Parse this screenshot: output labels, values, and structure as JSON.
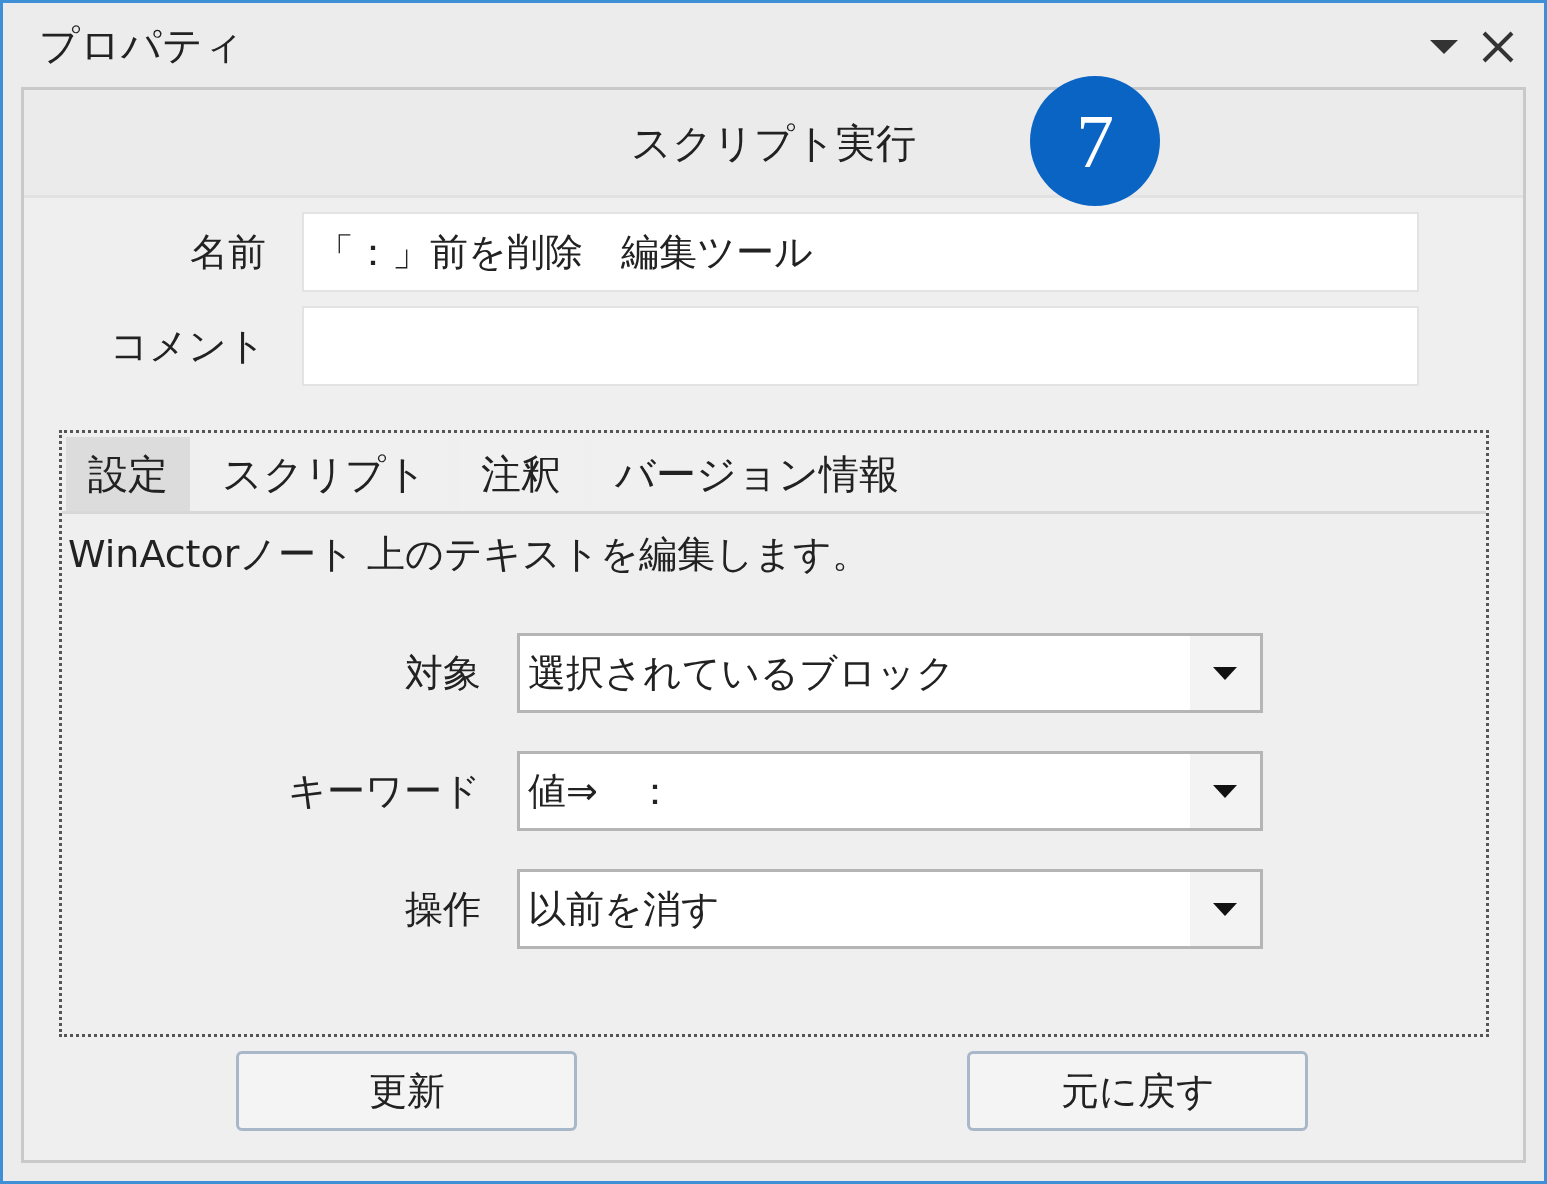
{
  "window": {
    "title": "プロパティ"
  },
  "header": {
    "title": "スクリプト実行",
    "step_badge": "7"
  },
  "fields": [
    {
      "label": "名前",
      "value": "「：」前を削除　編集ツール"
    },
    {
      "label": "コメント"
    }
  ],
  "tabs": [
    {
      "label": "設定",
      "selected": true
    },
    {
      "label": "スクリプト",
      "selected": false
    },
    {
      "label": "注釈",
      "selected": false
    },
    {
      "label": "バージョン情報",
      "selected": false
    }
  ],
  "description": "WinActorノート 上のテキストを編集します。",
  "settings": [
    {
      "label": "対象",
      "value": "選択されているブロック"
    },
    {
      "label": "キーワード",
      "value": "値⇒　："
    },
    {
      "label": "操作",
      "value": "以前を消す"
    }
  ],
  "buttons": [
    "更新",
    "元に戻す"
  ]
}
